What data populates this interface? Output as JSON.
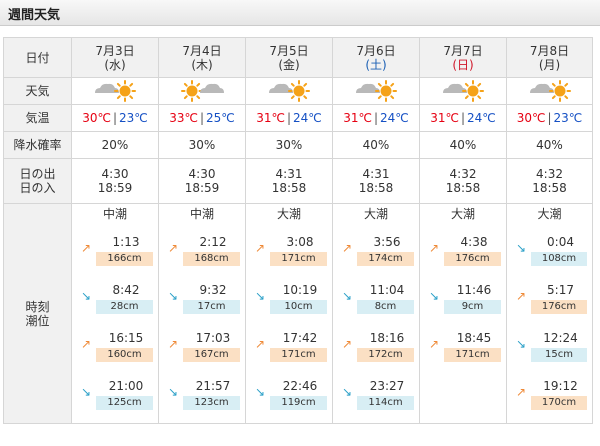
{
  "header": {
    "title": "週間天気"
  },
  "labels": {
    "date": "日付",
    "weather": "天気",
    "temperature": "気温",
    "precip": "降水確率",
    "sunrise": "日の出",
    "sunset": "日の入",
    "tide_time": "時刻",
    "tide_level": "潮位"
  },
  "temp_separator": "|",
  "colors": {
    "high_temp": "#e60012",
    "low_temp": "#1550c4",
    "saturday": "#1a5fb4",
    "sunday_holiday": "#d0182b",
    "sun": "#f5a218",
    "cloud": "#b9b9b9",
    "flood_arrow": "#ef8a38",
    "ebb_arrow": "#2ba0c8",
    "high_tide_bg": "#fbe0c4",
    "low_tide_bg": "#d8eef4"
  },
  "days": [
    {
      "date": "7月3日",
      "dow": "(水)",
      "dow_type": "weekday",
      "weather_icon": "cloud-then-sun-icon",
      "high": "30℃",
      "low": "23℃",
      "precip": "20%",
      "sunrise": "4:30",
      "sunset": "18:59",
      "tide_name": "中潮",
      "tides": [
        {
          "dir": "up",
          "time": "1:13",
          "level": "166cm"
        },
        {
          "dir": "down",
          "time": "8:42",
          "level": "28cm"
        },
        {
          "dir": "up",
          "time": "16:15",
          "level": "160cm"
        },
        {
          "dir": "down",
          "time": "21:00",
          "level": "125cm"
        }
      ]
    },
    {
      "date": "7月4日",
      "dow": "(木)",
      "dow_type": "weekday",
      "weather_icon": "sun-then-cloud-icon",
      "high": "33℃",
      "low": "25℃",
      "precip": "30%",
      "sunrise": "4:30",
      "sunset": "18:59",
      "tide_name": "中潮",
      "tides": [
        {
          "dir": "up",
          "time": "2:12",
          "level": "168cm"
        },
        {
          "dir": "down",
          "time": "9:32",
          "level": "17cm"
        },
        {
          "dir": "up",
          "time": "17:03",
          "level": "167cm"
        },
        {
          "dir": "down",
          "time": "21:57",
          "level": "123cm"
        }
      ]
    },
    {
      "date": "7月5日",
      "dow": "(金)",
      "dow_type": "weekday",
      "weather_icon": "cloud-then-sun-icon",
      "high": "31℃",
      "low": "24℃",
      "precip": "30%",
      "sunrise": "4:31",
      "sunset": "18:58",
      "tide_name": "大潮",
      "tides": [
        {
          "dir": "up",
          "time": "3:08",
          "level": "171cm"
        },
        {
          "dir": "down",
          "time": "10:19",
          "level": "10cm"
        },
        {
          "dir": "up",
          "time": "17:42",
          "level": "171cm"
        },
        {
          "dir": "down",
          "time": "22:46",
          "level": "119cm"
        }
      ]
    },
    {
      "date": "7月6日",
      "dow": "(土)",
      "dow_type": "saturday",
      "weather_icon": "cloud-then-sun-icon",
      "high": "31℃",
      "low": "24℃",
      "precip": "40%",
      "sunrise": "4:31",
      "sunset": "18:58",
      "tide_name": "大潮",
      "tides": [
        {
          "dir": "up",
          "time": "3:56",
          "level": "174cm"
        },
        {
          "dir": "down",
          "time": "11:04",
          "level": "8cm"
        },
        {
          "dir": "up",
          "time": "18:16",
          "level": "172cm"
        },
        {
          "dir": "down",
          "time": "23:27",
          "level": "114cm"
        }
      ]
    },
    {
      "date": "7月7日",
      "dow": "(日)",
      "dow_type": "sunday",
      "weather_icon": "cloud-then-sun-icon",
      "high": "31℃",
      "low": "24℃",
      "precip": "40%",
      "sunrise": "4:32",
      "sunset": "18:58",
      "tide_name": "大潮",
      "tides": [
        {
          "dir": "up",
          "time": "4:38",
          "level": "176cm"
        },
        {
          "dir": "down",
          "time": "11:46",
          "level": "9cm"
        },
        {
          "dir": "up",
          "time": "18:45",
          "level": "171cm"
        }
      ]
    },
    {
      "date": "7月8日",
      "dow": "(月)",
      "dow_type": "weekday",
      "weather_icon": "cloud-then-sun-icon",
      "high": "30℃",
      "low": "23℃",
      "precip": "40%",
      "sunrise": "4:32",
      "sunset": "18:58",
      "tide_name": "大潮",
      "tides": [
        {
          "dir": "down",
          "time": "0:04",
          "level": "108cm"
        },
        {
          "dir": "up",
          "time": "5:17",
          "level": "176cm"
        },
        {
          "dir": "down",
          "time": "12:24",
          "level": "15cm"
        },
        {
          "dir": "up",
          "time": "19:12",
          "level": "170cm"
        }
      ]
    }
  ]
}
